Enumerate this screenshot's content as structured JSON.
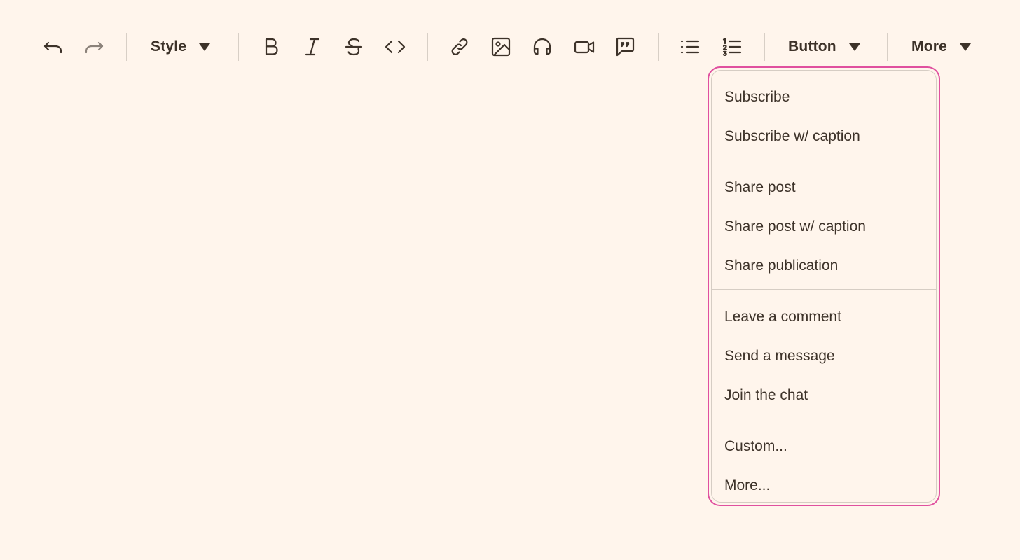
{
  "toolbar": {
    "style_label": "Style",
    "button_label": "Button",
    "more_label": "More",
    "icons": [
      "undo-icon",
      "redo-icon",
      "bold-icon",
      "italic-icon",
      "strikethrough-icon",
      "code-icon",
      "link-icon",
      "image-icon",
      "audio-icon",
      "video-icon",
      "quote-icon",
      "bullet-list-icon",
      "numbered-list-icon"
    ],
    "redo_disabled": true
  },
  "button_menu": {
    "items": [
      "Subscribe",
      "Subscribe w/ caption",
      "Share post",
      "Share post w/ caption",
      "Share publication",
      "Leave a comment",
      "Send a message",
      "Join the chat",
      "Custom...",
      "More..."
    ],
    "highlight_color": "#e0509f"
  },
  "colors": {
    "background": "#fff5ec",
    "text": "#3d3229"
  }
}
